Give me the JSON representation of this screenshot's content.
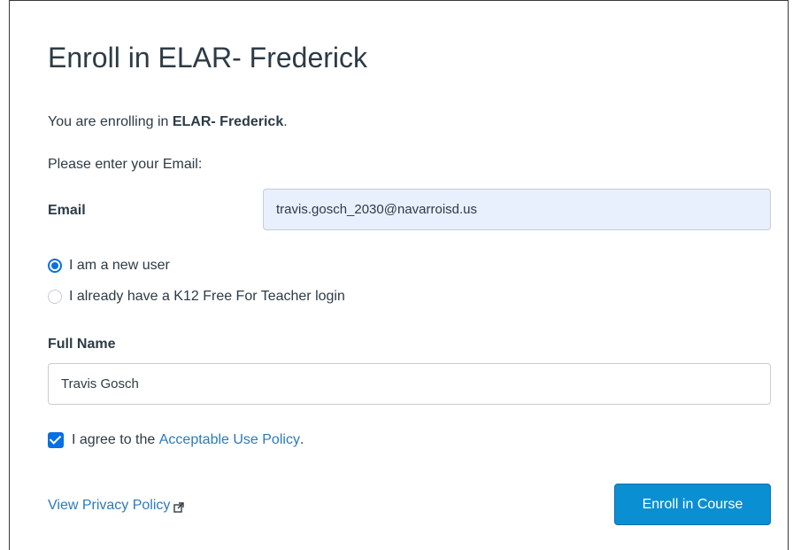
{
  "page": {
    "title": "Enroll in ELAR- Frederick"
  },
  "intro": {
    "prefix": "You are enrolling in ",
    "course_name": "ELAR- Frederick",
    "suffix": "."
  },
  "email_prompt": "Please enter your Email:",
  "email": {
    "label": "Email",
    "value": "travis.gosch_2030@navarroisd.us"
  },
  "user_type": {
    "options": [
      {
        "label": "I am a new user",
        "selected": true
      },
      {
        "label": "I already have a K12 Free For Teacher login",
        "selected": false
      }
    ]
  },
  "full_name": {
    "label": "Full Name",
    "value": "Travis Gosch"
  },
  "agreement": {
    "prefix": "I agree to the ",
    "link_text": "Acceptable Use Policy",
    "suffix": ".",
    "checked": true
  },
  "footer": {
    "privacy_link": "View Privacy Policy",
    "enroll_button": "Enroll in Course"
  },
  "colors": {
    "accent": "#0770e3",
    "link": "#2b7abc",
    "button": "#0b8fd3",
    "autofill_bg": "#e8f0fe"
  },
  "icons": {
    "external_link": "external-link-icon"
  }
}
